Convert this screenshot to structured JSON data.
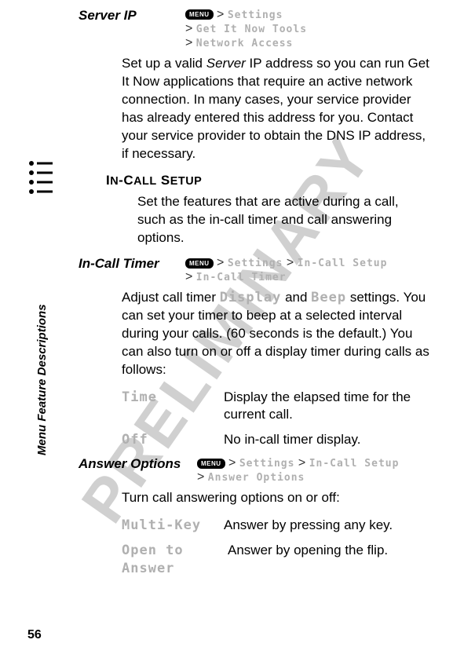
{
  "watermark": "PRELIMINARY",
  "sideLabel": "Menu Feature Descriptions",
  "pageNumber": "56",
  "menuBadge": "MENU",
  "serverIp": {
    "title": "Server IP",
    "path1": "Settings",
    "path2": "Get It Now Tools",
    "path3": "Network Access",
    "body": "Set up a valid Server IP address so you can run Get It Now applications that require an active network connection. In many cases, your service provider has already entered this address for you. Contact your service provider to obtain the DNS IP address, if necessary.",
    "italicWord": "Server"
  },
  "inCallSetup": {
    "heading": "In-Call Setup",
    "body": "Set the features that are active during a call, such as the in-call timer and call answering options."
  },
  "inCallTimer": {
    "title": "In-Call Timer",
    "path1": "Settings",
    "path2": "In-Call Setup",
    "path3": "In-Call Timer",
    "body1a": "Adjust call timer ",
    "body1b": "Display",
    "body1c": " and ",
    "body1d": "Beep",
    "body1e": " settings. You can set your timer to beep at a selected interval during your calls. (60 seconds is the default.) You can also turn on or off a display timer during calls as follows:",
    "opt1key": "Time",
    "opt1desc": "Display the elapsed time for the current call.",
    "opt2key": "Off",
    "opt2desc": "No in-call timer display."
  },
  "answerOptions": {
    "title": "Answer Options",
    "path1": "Settings",
    "path2": "In-Call Setup",
    "path3": "Answer Options",
    "body": "Turn call answering options on or off:",
    "opt1key": "Multi-Key",
    "opt1desc": "Answer by pressing any key.",
    "opt2key": "Open to Answer",
    "opt2desc": "Answer by opening the flip."
  }
}
